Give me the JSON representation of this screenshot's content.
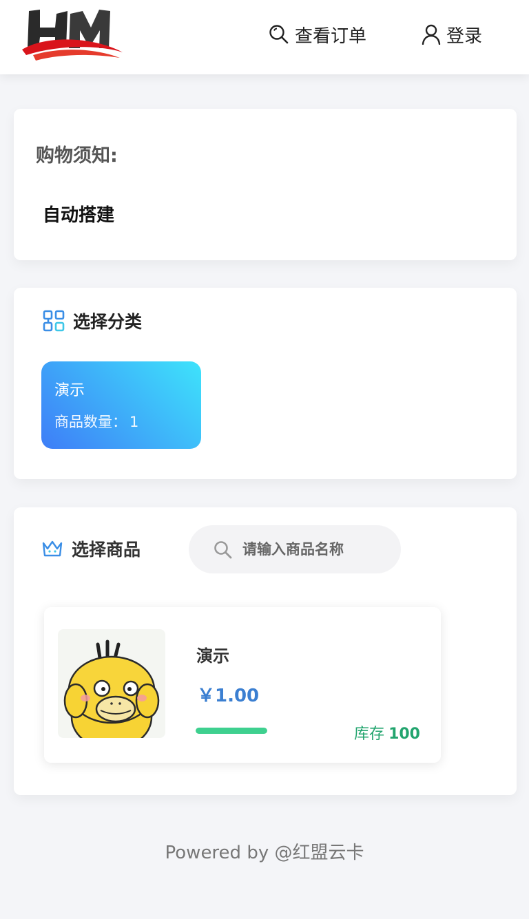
{
  "header": {
    "logo_text": "HM",
    "nav": {
      "orders_label": "查看订单",
      "login_label": "登录"
    }
  },
  "notice": {
    "title": "购物须知:",
    "body": "自动搭建"
  },
  "category": {
    "title": "选择分类",
    "items": [
      {
        "name": "演示",
        "count_label": "商品数量：",
        "count": 1
      }
    ]
  },
  "goods": {
    "title": "选择商品",
    "search": {
      "placeholder": "请输入商品名称",
      "value": ""
    },
    "items": [
      {
        "name": "演示",
        "price": "￥1.00",
        "stock_label": "库存",
        "stock": 100,
        "stock_level": 1.0
      }
    ]
  },
  "footer": {
    "text": "Powered by @红盟云卡"
  },
  "colors": {
    "accent_blue": "#3b7fd1",
    "stock_green": "#22a46e",
    "category_gradient_start": "#3e7df7",
    "category_gradient_end": "#3ee3fb"
  },
  "icons": {
    "orders": "search-icon",
    "login": "user-icon",
    "category": "grid-icon",
    "goods": "crown-icon",
    "search": "search-icon"
  }
}
